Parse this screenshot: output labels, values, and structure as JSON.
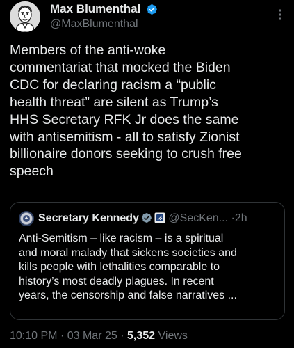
{
  "author": {
    "display_name": "Max Blumenthal",
    "handle": "@MaxBlumenthal",
    "verified_icon": "verified-badge-icon",
    "avatar": "caricature-avatar"
  },
  "post": {
    "text": "Members of the anti-woke\ncommentariat that mocked the Biden\nCDC for declaring racism a “public\nhealth threat” are silent as Trump’s\nHHS Secretary RFK Jr does the same\nwith antisemitism - all to satisfy Zionist\nbillionaire donors seeking to crush free\nspeech"
  },
  "quoted_post": {
    "display_name": "Secretary Kennedy",
    "handle": "@SecKen...",
    "separator": "·",
    "time": "2h",
    "text": "Anti-Semitism – like racism – is a spiritual\nand moral malady that sickens societies and\nkills people with lethalities comparable to\nhistory’s most deadly plagues. In recent\nyears, the censorship and false narratives ..."
  },
  "meta": {
    "time": "10:10 PM",
    "date": "03 Mar 25",
    "separator": "·",
    "views_count": "5,352",
    "views_label": "Views"
  },
  "colors": {
    "background": "#000000",
    "primary_text": "#e7e9ea",
    "secondary_text": "#71767b",
    "verified_blue": "#1d9bf0",
    "government_gray": "#829aab",
    "border": "#2f3336"
  }
}
